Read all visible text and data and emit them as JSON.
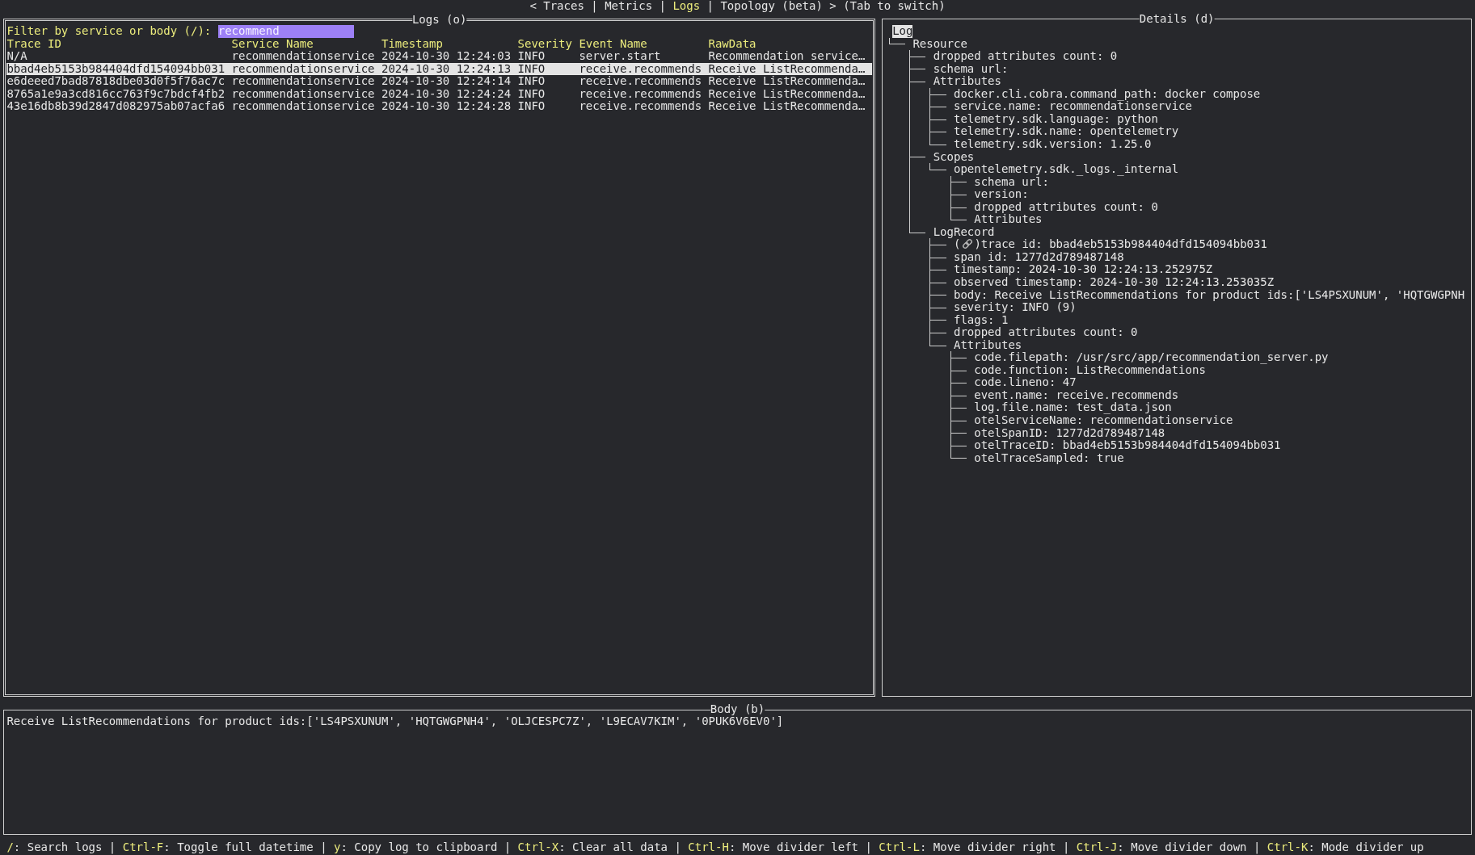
{
  "tab_bar": {
    "prev": "<",
    "tabs": [
      {
        "label": "Traces",
        "selected": false,
        "separator": "|"
      },
      {
        "label": "Metrics",
        "selected": false,
        "separator": "|"
      },
      {
        "label": "Logs",
        "selected": true,
        "separator": "|"
      },
      {
        "label": "Topology (beta)",
        "selected": false
      }
    ],
    "next": ">",
    "hint": "(Tab to switch)"
  },
  "logs_panel": {
    "title": "Logs (o)",
    "focused": true,
    "filter": {
      "label": "Filter by service or body (/):",
      "value": "recommend"
    },
    "table": {
      "columns": [
        "Trace ID",
        "Service Name",
        "Timestamp",
        "Severity",
        "Event Name",
        "RawData"
      ],
      "rows": [
        {
          "selected": false,
          "cells": [
            "N/A",
            "recommendationservice",
            "2024-10-30 12:24:03",
            "INFO",
            "server.start",
            "Recommendation service…"
          ]
        },
        {
          "selected": true,
          "cells": [
            "bbad4eb5153b984404dfd154094bb031",
            "recommendationservice",
            "2024-10-30 12:24:13",
            "INFO",
            "receive.recommends",
            "Receive ListRecommenda…"
          ]
        },
        {
          "selected": false,
          "cells": [
            "e6deeed7bad87818dbe03d0f5f76ac7c",
            "recommendationservice",
            "2024-10-30 12:24:14",
            "INFO",
            "receive.recommends",
            "Receive ListRecommenda…"
          ]
        },
        {
          "selected": false,
          "cells": [
            "8765a1e9a3cd816cc763f9c7bdcf4fb2",
            "recommendationservice",
            "2024-10-30 12:24:24",
            "INFO",
            "receive.recommends",
            "Receive ListRecommenda…"
          ]
        },
        {
          "selected": false,
          "cells": [
            "43e16db8b39d2847d082975ab07acfa6",
            "recommendationservice",
            "2024-10-30 12:24:28",
            "INFO",
            "receive.recommends",
            "Receive ListRecommenda…"
          ]
        }
      ]
    }
  },
  "details_panel": {
    "title": "Details (d)",
    "focused": false,
    "tree": {
      "label": "Log",
      "selected": true,
      "children": [
        {
          "label": "Resource",
          "selected": false,
          "children": [
            {
              "label": "dropped attributes count: 0",
              "selected": false
            },
            {
              "label": "schema url:",
              "selected": false
            },
            {
              "label": "Attributes",
              "selected": false,
              "children": [
                {
                  "label": "docker.cli.cobra.command_path: docker compose",
                  "selected": false
                },
                {
                  "label": "service.name: recommendationservice",
                  "selected": false
                },
                {
                  "label": "telemetry.sdk.language: python",
                  "selected": false
                },
                {
                  "label": "telemetry.sdk.name: opentelemetry",
                  "selected": false
                },
                {
                  "label": "telemetry.sdk.version: 1.25.0",
                  "selected": false
                }
              ]
            },
            {
              "label": "Scopes",
              "selected": false,
              "children": [
                {
                  "label": "opentelemetry.sdk._logs._internal",
                  "selected": false,
                  "children": [
                    {
                      "label": "schema url:",
                      "selected": false
                    },
                    {
                      "label": "version:",
                      "selected": false
                    },
                    {
                      "label": "dropped attributes count: 0",
                      "selected": false
                    },
                    {
                      "label": "Attributes",
                      "selected": false
                    }
                  ]
                }
              ]
            },
            {
              "label": "LogRecord",
              "selected": false,
              "children": [
                {
                  "kind": "link",
                  "label": "trace id: bbad4eb5153b984404dfd154094bb031",
                  "selected": false,
                  "icon_open": "(",
                  "icon_close": ")"
                },
                {
                  "kind": "plain",
                  "label": "span id: 1277d2d789487148",
                  "selected": false
                },
                {
                  "kind": "plain",
                  "label": "timestamp: 2024-10-30 12:24:13.252975Z",
                  "selected": false
                },
                {
                  "kind": "plain",
                  "label": "observed timestamp: 2024-10-30 12:24:13.253035Z",
                  "selected": false
                },
                {
                  "kind": "plain",
                  "label": "body: Receive ListRecommendations for product ids:['LS4PSXUNUM', 'HQTGWGPNH",
                  "selected": false
                },
                {
                  "kind": "plain",
                  "label": "severity: INFO (9)",
                  "selected": false
                },
                {
                  "kind": "plain",
                  "label": "flags: 1",
                  "selected": false
                },
                {
                  "kind": "plain",
                  "label": "dropped attributes count: 0",
                  "selected": false
                },
                {
                  "kind": "plain",
                  "label": "Attributes",
                  "selected": false,
                  "children": [
                    {
                      "label": "code.filepath: /usr/src/app/recommendation_server.py",
                      "selected": false
                    },
                    {
                      "label": "code.function: ListRecommendations",
                      "selected": false
                    },
                    {
                      "label": "code.lineno: 47",
                      "selected": false
                    },
                    {
                      "label": "event.name: receive.recommends",
                      "selected": false
                    },
                    {
                      "label": "log.file.name: test_data.json",
                      "selected": false
                    },
                    {
                      "label": "otelServiceName: recommendationservice",
                      "selected": false
                    },
                    {
                      "label": "otelSpanID: 1277d2d789487148",
                      "selected": false
                    },
                    {
                      "label": "otelTraceID: bbad4eb5153b984404dfd154094bb031",
                      "selected": false
                    },
                    {
                      "label": "otelTraceSampled: true",
                      "selected": false
                    }
                  ]
                }
              ]
            }
          ]
        }
      ]
    }
  },
  "body_panel": {
    "title": "Body (b)",
    "focused": false,
    "text": "Receive ListRecommendations for product ids:['LS4PSXUNUM', 'HQTGWGPNH4', 'OLJCESPC7Z', 'L9ECAV7KIM', '0PUK6V6EV0']"
  },
  "status_bar": [
    {
      "key": "/",
      "text": ": Search logs",
      "separator": "|"
    },
    {
      "key": "Ctrl-F",
      "text": ": Toggle full datetime",
      "separator": "|"
    },
    {
      "key": "y",
      "text": ": Copy log to clipboard",
      "separator": "|"
    },
    {
      "key": "Ctrl-X",
      "text": ": Clear all data",
      "separator": "|"
    },
    {
      "key": "Ctrl-H",
      "text": ": Move divider left",
      "separator": "|"
    },
    {
      "key": "Ctrl-L",
      "text": ": Move divider right",
      "separator": "|"
    },
    {
      "key": "Ctrl-J",
      "text": ": Move divider down",
      "separator": "|"
    },
    {
      "key": "Ctrl-K",
      "text": ": Mode divider up"
    }
  ]
}
